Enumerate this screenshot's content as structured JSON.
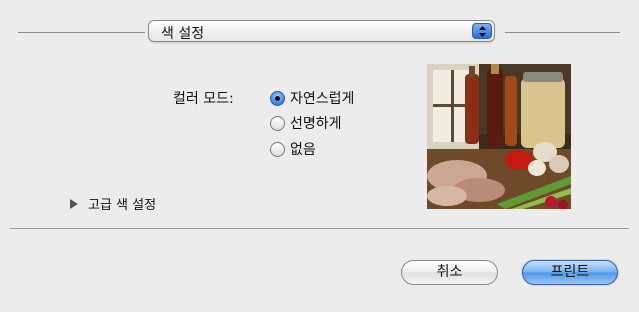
{
  "dialog": {
    "section_popup": {
      "selected": "색 설정"
    },
    "color_mode": {
      "label": "컬러 모드:",
      "options": [
        {
          "label": "자연스럽게",
          "checked": true
        },
        {
          "label": "선명하게",
          "checked": false
        },
        {
          "label": "없음",
          "checked": false
        }
      ]
    },
    "advanced_label": "고급 색 설정",
    "buttons": {
      "cancel": "취소",
      "print": "프린트"
    },
    "colors": {
      "default_button": "#5a9be8",
      "background": "#ececec"
    }
  }
}
